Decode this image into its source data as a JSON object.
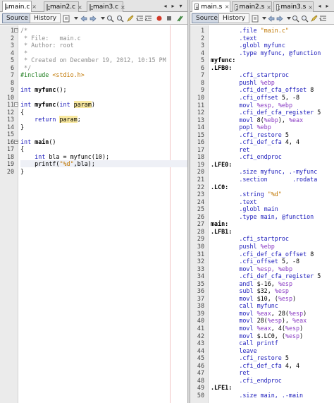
{
  "left": {
    "tabs": [
      {
        "label": "main.c",
        "active": true
      },
      {
        "label": "main2.c",
        "active": false
      },
      {
        "label": "main3.c",
        "active": false
      }
    ],
    "toolbar": {
      "source": "Source",
      "history": "History"
    },
    "lines": [
      {
        "n": "1",
        "t": [
          [
            "/*",
            "c-comment"
          ]
        ]
      },
      {
        "n": "2",
        "t": [
          [
            " * File:   main.c",
            "c-comment"
          ]
        ]
      },
      {
        "n": "3",
        "t": [
          [
            " * Author: root",
            "c-comment"
          ]
        ]
      },
      {
        "n": "4",
        "t": [
          [
            " *",
            "c-comment"
          ]
        ]
      },
      {
        "n": "5",
        "t": [
          [
            " * Created on December 19, 2012, 10:15 PM",
            "c-comment"
          ]
        ]
      },
      {
        "n": "6",
        "t": [
          [
            " */",
            "c-comment"
          ]
        ]
      },
      {
        "n": "7",
        "t": [
          [
            "#include ",
            "c-pre"
          ],
          [
            "<stdio.h>",
            "c-str"
          ]
        ]
      },
      {
        "n": "8",
        "t": []
      },
      {
        "n": "9",
        "t": [
          [
            "int ",
            "c-kw"
          ],
          [
            "myfunc",
            "c-bold"
          ],
          [
            "();",
            ""
          ]
        ]
      },
      {
        "n": "10",
        "t": []
      },
      {
        "n": "11",
        "t": [
          [
            "int ",
            "c-kw"
          ],
          [
            "myfunc",
            "c-bold"
          ],
          [
            "(",
            ""
          ],
          [
            "int ",
            "c-kw"
          ],
          [
            "param",
            "c-hl"
          ],
          [
            ")",
            ""
          ]
        ]
      },
      {
        "n": "12",
        "t": [
          [
            "{",
            ""
          ]
        ]
      },
      {
        "n": "13",
        "t": [
          [
            "    ",
            ""
          ],
          [
            "return ",
            "c-kw"
          ],
          [
            "param",
            "c-hl"
          ],
          [
            ";",
            ""
          ]
        ]
      },
      {
        "n": "14",
        "t": [
          [
            "}",
            ""
          ]
        ]
      },
      {
        "n": "15",
        "t": []
      },
      {
        "n": "16",
        "t": [
          [
            "int ",
            "c-kw"
          ],
          [
            "main",
            "c-bold"
          ],
          [
            "()",
            ""
          ]
        ]
      },
      {
        "n": "17",
        "t": [
          [
            "{",
            ""
          ]
        ]
      },
      {
        "n": "18",
        "t": [
          [
            "    ",
            ""
          ],
          [
            "int ",
            "c-kw"
          ],
          [
            "bla = myfunc(10);",
            ""
          ]
        ]
      },
      {
        "n": "19",
        "t": [
          [
            "    printf(",
            ""
          ],
          [
            "\"%d\"",
            "c-str"
          ],
          [
            ",bla);",
            ""
          ]
        ]
      },
      {
        "n": "20",
        "t": [
          [
            "}",
            ""
          ]
        ]
      }
    ]
  },
  "right": {
    "tabs": [
      {
        "label": "main.s",
        "active": true
      },
      {
        "label": "main2.s",
        "active": false
      },
      {
        "label": "main3.s",
        "active": false
      }
    ],
    "toolbar": {
      "source": "Source",
      "history": "History"
    },
    "lines": [
      {
        "n": "1",
        "t": [
          [
            "        .file ",
            "c-dir"
          ],
          [
            "\"main.c\"",
            "c-str"
          ]
        ]
      },
      {
        "n": "2",
        "t": [
          [
            "        .text",
            "c-dir"
          ]
        ]
      },
      {
        "n": "3",
        "t": [
          [
            "        .globl ",
            "c-dir"
          ],
          [
            "myfunc",
            "c-dir"
          ]
        ]
      },
      {
        "n": "4",
        "t": [
          [
            "        .type ",
            "c-dir"
          ],
          [
            "myfunc, @function",
            "c-dir"
          ]
        ]
      },
      {
        "n": "5",
        "t": [
          [
            "myfunc:",
            "c-label"
          ]
        ]
      },
      {
        "n": "6",
        "t": [
          [
            ".LFB0:",
            "c-label"
          ]
        ]
      },
      {
        "n": "7",
        "t": [
          [
            "        .cfi_startproc",
            "c-dir"
          ]
        ]
      },
      {
        "n": "8",
        "t": [
          [
            "        pushl ",
            "c-dir"
          ],
          [
            "%ebp",
            "c-reg"
          ]
        ]
      },
      {
        "n": "9",
        "t": [
          [
            "        .cfi_def_cfa_offset ",
            "c-dir"
          ],
          [
            "8",
            "c-num"
          ]
        ]
      },
      {
        "n": "10",
        "t": [
          [
            "        .cfi_offset ",
            "c-dir"
          ],
          [
            "5, -8",
            "c-num"
          ]
        ]
      },
      {
        "n": "11",
        "t": [
          [
            "        movl ",
            "c-dir"
          ],
          [
            "%esp, %ebp",
            "c-reg"
          ]
        ]
      },
      {
        "n": "12",
        "t": [
          [
            "        .cfi_def_cfa_register ",
            "c-dir"
          ],
          [
            "5",
            "c-num"
          ]
        ]
      },
      {
        "n": "13",
        "t": [
          [
            "        movl ",
            "c-dir"
          ],
          [
            "8(",
            "c-num"
          ],
          [
            "%ebp",
            "c-reg"
          ],
          [
            "), ",
            "c-num"
          ],
          [
            "%eax",
            "c-reg"
          ]
        ]
      },
      {
        "n": "14",
        "t": [
          [
            "        popl ",
            "c-dir"
          ],
          [
            "%ebp",
            "c-reg"
          ]
        ]
      },
      {
        "n": "15",
        "t": [
          [
            "        .cfi_restore ",
            "c-dir"
          ],
          [
            "5",
            "c-num"
          ]
        ]
      },
      {
        "n": "16",
        "t": [
          [
            "        .cfi_def_cfa ",
            "c-dir"
          ],
          [
            "4, 4",
            "c-num"
          ]
        ]
      },
      {
        "n": "17",
        "t": [
          [
            "        ret",
            "c-dir"
          ]
        ]
      },
      {
        "n": "18",
        "t": [
          [
            "        .cfi_endproc",
            "c-dir"
          ]
        ]
      },
      {
        "n": "19",
        "t": [
          [
            ".LFE0:",
            "c-label"
          ]
        ]
      },
      {
        "n": "20",
        "t": [
          [
            "        .size ",
            "c-dir"
          ],
          [
            "myfunc, .-myfunc",
            "c-dir"
          ]
        ]
      },
      {
        "n": "21",
        "t": [
          [
            "        .section ",
            "c-dir"
          ],
          [
            "      .rodata",
            "c-dir"
          ]
        ]
      },
      {
        "n": "22",
        "t": [
          [
            ".LC0:",
            "c-label"
          ]
        ]
      },
      {
        "n": "23",
        "t": [
          [
            "        .string ",
            "c-dir"
          ],
          [
            "\"%d\"",
            "c-str"
          ]
        ]
      },
      {
        "n": "24",
        "t": [
          [
            "        .text",
            "c-dir"
          ]
        ]
      },
      {
        "n": "25",
        "t": [
          [
            "        .globl ",
            "c-dir"
          ],
          [
            "main",
            "c-dir"
          ]
        ]
      },
      {
        "n": "26",
        "t": [
          [
            "        .type ",
            "c-dir"
          ],
          [
            "main, @function",
            "c-dir"
          ]
        ]
      },
      {
        "n": "27",
        "t": [
          [
            "main:",
            "c-label"
          ]
        ]
      },
      {
        "n": "28",
        "t": [
          [
            ".LFB1:",
            "c-label"
          ]
        ]
      },
      {
        "n": "29",
        "t": [
          [
            "        .cfi_startproc",
            "c-dir"
          ]
        ]
      },
      {
        "n": "30",
        "t": [
          [
            "        pushl ",
            "c-dir"
          ],
          [
            "%ebp",
            "c-reg"
          ]
        ]
      },
      {
        "n": "31",
        "t": [
          [
            "        .cfi_def_cfa_offset ",
            "c-dir"
          ],
          [
            "8",
            "c-num"
          ]
        ]
      },
      {
        "n": "32",
        "t": [
          [
            "        .cfi_offset ",
            "c-dir"
          ],
          [
            "5, -8",
            "c-num"
          ]
        ]
      },
      {
        "n": "33",
        "t": [
          [
            "        movl ",
            "c-dir"
          ],
          [
            "%esp, %ebp",
            "c-reg"
          ]
        ]
      },
      {
        "n": "34",
        "t": [
          [
            "        .cfi_def_cfa_register ",
            "c-dir"
          ],
          [
            "5",
            "c-num"
          ]
        ]
      },
      {
        "n": "35",
        "t": [
          [
            "        andl ",
            "c-dir"
          ],
          [
            "$-16, ",
            "c-num"
          ],
          [
            "%esp",
            "c-reg"
          ]
        ]
      },
      {
        "n": "36",
        "t": [
          [
            "        subl ",
            "c-dir"
          ],
          [
            "$32, ",
            "c-num"
          ],
          [
            "%esp",
            "c-reg"
          ]
        ]
      },
      {
        "n": "37",
        "t": [
          [
            "        movl ",
            "c-dir"
          ],
          [
            "$10, (",
            "c-num"
          ],
          [
            "%esp",
            "c-reg"
          ],
          [
            ")",
            "c-num"
          ]
        ]
      },
      {
        "n": "38",
        "t": [
          [
            "        call ",
            "c-dir"
          ],
          [
            "myfunc",
            "c-dir"
          ]
        ]
      },
      {
        "n": "39",
        "t": [
          [
            "        movl ",
            "c-dir"
          ],
          [
            "%eax",
            "c-reg"
          ],
          [
            ", 28(",
            "c-num"
          ],
          [
            "%esp",
            "c-reg"
          ],
          [
            ")",
            "c-num"
          ]
        ]
      },
      {
        "n": "40",
        "t": [
          [
            "        movl ",
            "c-dir"
          ],
          [
            "28(",
            "c-num"
          ],
          [
            "%esp",
            "c-reg"
          ],
          [
            "), ",
            "c-num"
          ],
          [
            "%eax",
            "c-reg"
          ]
        ]
      },
      {
        "n": "41",
        "t": [
          [
            "        movl ",
            "c-dir"
          ],
          [
            "%eax",
            "c-reg"
          ],
          [
            ", 4(",
            "c-num"
          ],
          [
            "%esp",
            "c-reg"
          ],
          [
            ")",
            "c-num"
          ]
        ]
      },
      {
        "n": "42",
        "t": [
          [
            "        movl ",
            "c-dir"
          ],
          [
            "$.LC0, (",
            "c-num"
          ],
          [
            "%esp",
            "c-reg"
          ],
          [
            ")",
            "c-num"
          ]
        ]
      },
      {
        "n": "43",
        "t": [
          [
            "        call ",
            "c-dir"
          ],
          [
            "printf",
            "c-dir"
          ]
        ]
      },
      {
        "n": "44",
        "t": [
          [
            "        leave",
            "c-dir"
          ]
        ]
      },
      {
        "n": "45",
        "t": [
          [
            "        .cfi_restore ",
            "c-dir"
          ],
          [
            "5",
            "c-num"
          ]
        ]
      },
      {
        "n": "46",
        "t": [
          [
            "        .cfi_def_cfa ",
            "c-dir"
          ],
          [
            "4, 4",
            "c-num"
          ]
        ]
      },
      {
        "n": "47",
        "t": [
          [
            "        ret",
            "c-dir"
          ]
        ]
      },
      {
        "n": "48",
        "t": [
          [
            "        .cfi_endproc",
            "c-dir"
          ]
        ]
      },
      {
        "n": "49",
        "t": [
          [
            ".LFE1:",
            "c-label"
          ]
        ]
      },
      {
        "n": "50",
        "t": [
          [
            "        .size ",
            "c-dir"
          ],
          [
            "main, .-main",
            "c-dir"
          ]
        ]
      }
    ]
  },
  "icons": {
    "tab_close": "close-icon",
    "nav_left": "chevron-left-icon",
    "nav_right": "chevron-right-icon",
    "nav_menu": "dropdown-icon"
  },
  "colors": {
    "comment": "#8c8c8c",
    "preprocessor": "#1b7c1b",
    "keyword": "#1b1bbb",
    "string": "#c07600",
    "highlight": "#f9e9a0",
    "register": "#8a3cc4",
    "current_line": "#eef0f6"
  },
  "glyphs": {
    "close": "×",
    "left": "◂",
    "right": "▸",
    "menu": "▾"
  }
}
